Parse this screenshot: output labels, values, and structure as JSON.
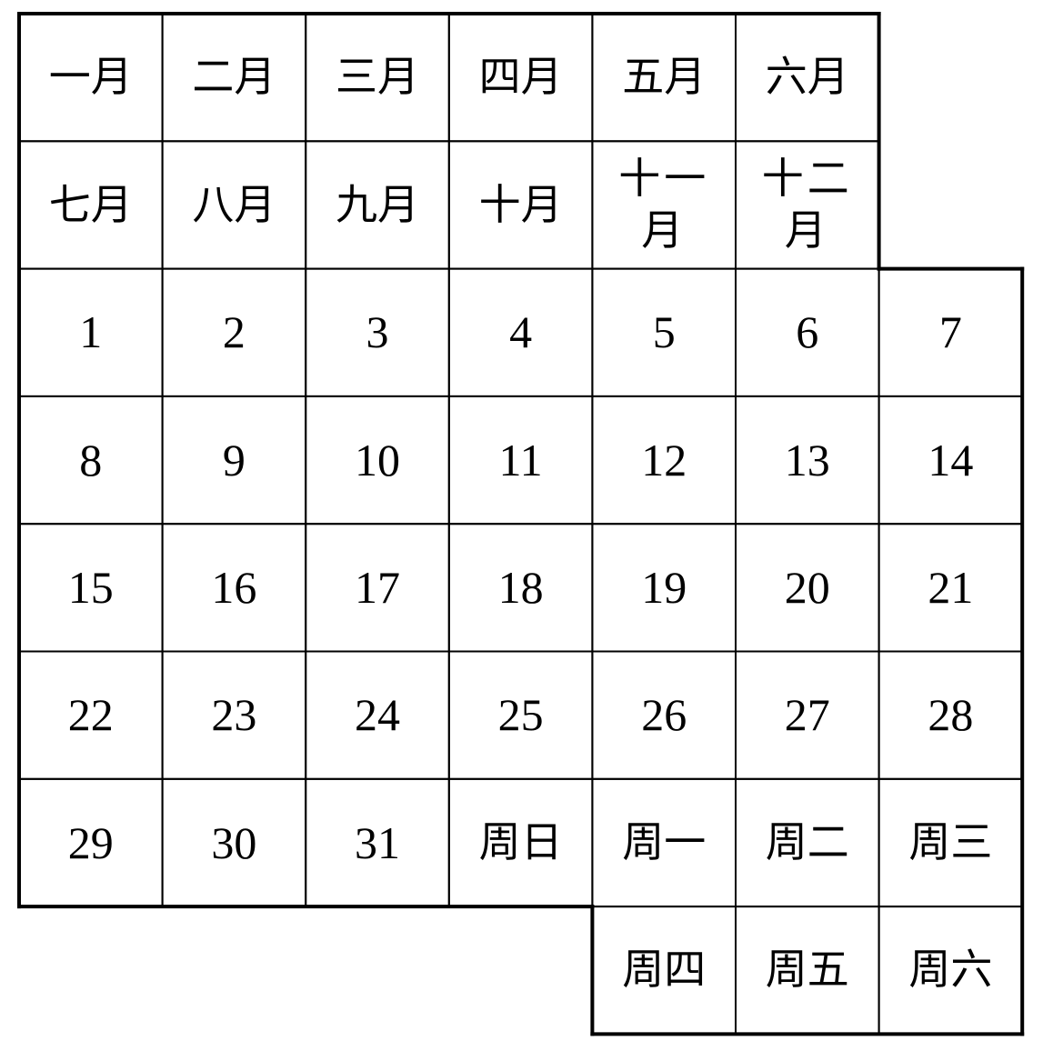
{
  "colors": {
    "line": "#000000",
    "text": "#000000",
    "background": "#ffffff"
  },
  "rows": [
    {
      "offset": 0,
      "cells": [
        {
          "text": "一月",
          "kind": "month"
        },
        {
          "text": "二月",
          "kind": "month"
        },
        {
          "text": "三月",
          "kind": "month"
        },
        {
          "text": "四月",
          "kind": "month"
        },
        {
          "text": "五月",
          "kind": "month"
        },
        {
          "text": "六月",
          "kind": "month"
        }
      ]
    },
    {
      "offset": 0,
      "cells": [
        {
          "text": "七月",
          "kind": "month"
        },
        {
          "text": "八月",
          "kind": "month"
        },
        {
          "text": "九月",
          "kind": "month"
        },
        {
          "text": "十月",
          "kind": "month"
        },
        {
          "text": "十一月",
          "kind": "month"
        },
        {
          "text": "十二月",
          "kind": "month"
        }
      ]
    },
    {
      "offset": 0,
      "cells": [
        {
          "text": "1",
          "kind": "day"
        },
        {
          "text": "2",
          "kind": "day"
        },
        {
          "text": "3",
          "kind": "day"
        },
        {
          "text": "4",
          "kind": "day"
        },
        {
          "text": "5",
          "kind": "day"
        },
        {
          "text": "6",
          "kind": "day"
        },
        {
          "text": "7",
          "kind": "day"
        }
      ]
    },
    {
      "offset": 0,
      "cells": [
        {
          "text": "8",
          "kind": "day"
        },
        {
          "text": "9",
          "kind": "day"
        },
        {
          "text": "10",
          "kind": "day"
        },
        {
          "text": "11",
          "kind": "day"
        },
        {
          "text": "12",
          "kind": "day"
        },
        {
          "text": "13",
          "kind": "day"
        },
        {
          "text": "14",
          "kind": "day"
        }
      ]
    },
    {
      "offset": 0,
      "cells": [
        {
          "text": "15",
          "kind": "day"
        },
        {
          "text": "16",
          "kind": "day"
        },
        {
          "text": "17",
          "kind": "day"
        },
        {
          "text": "18",
          "kind": "day"
        },
        {
          "text": "19",
          "kind": "day"
        },
        {
          "text": "20",
          "kind": "day"
        },
        {
          "text": "21",
          "kind": "day"
        }
      ]
    },
    {
      "offset": 0,
      "cells": [
        {
          "text": "22",
          "kind": "day"
        },
        {
          "text": "23",
          "kind": "day"
        },
        {
          "text": "24",
          "kind": "day"
        },
        {
          "text": "25",
          "kind": "day"
        },
        {
          "text": "26",
          "kind": "day"
        },
        {
          "text": "27",
          "kind": "day"
        },
        {
          "text": "28",
          "kind": "day"
        }
      ]
    },
    {
      "offset": 0,
      "cells": [
        {
          "text": "29",
          "kind": "day"
        },
        {
          "text": "30",
          "kind": "day"
        },
        {
          "text": "31",
          "kind": "day"
        },
        {
          "text": "周日",
          "kind": "weekday"
        },
        {
          "text": "周一",
          "kind": "weekday"
        },
        {
          "text": "周二",
          "kind": "weekday"
        },
        {
          "text": "周三",
          "kind": "weekday"
        }
      ]
    },
    {
      "offset": 4,
      "cells": [
        {
          "text": "周四",
          "kind": "weekday"
        },
        {
          "text": "周五",
          "kind": "weekday"
        },
        {
          "text": "周六",
          "kind": "weekday"
        }
      ]
    }
  ]
}
